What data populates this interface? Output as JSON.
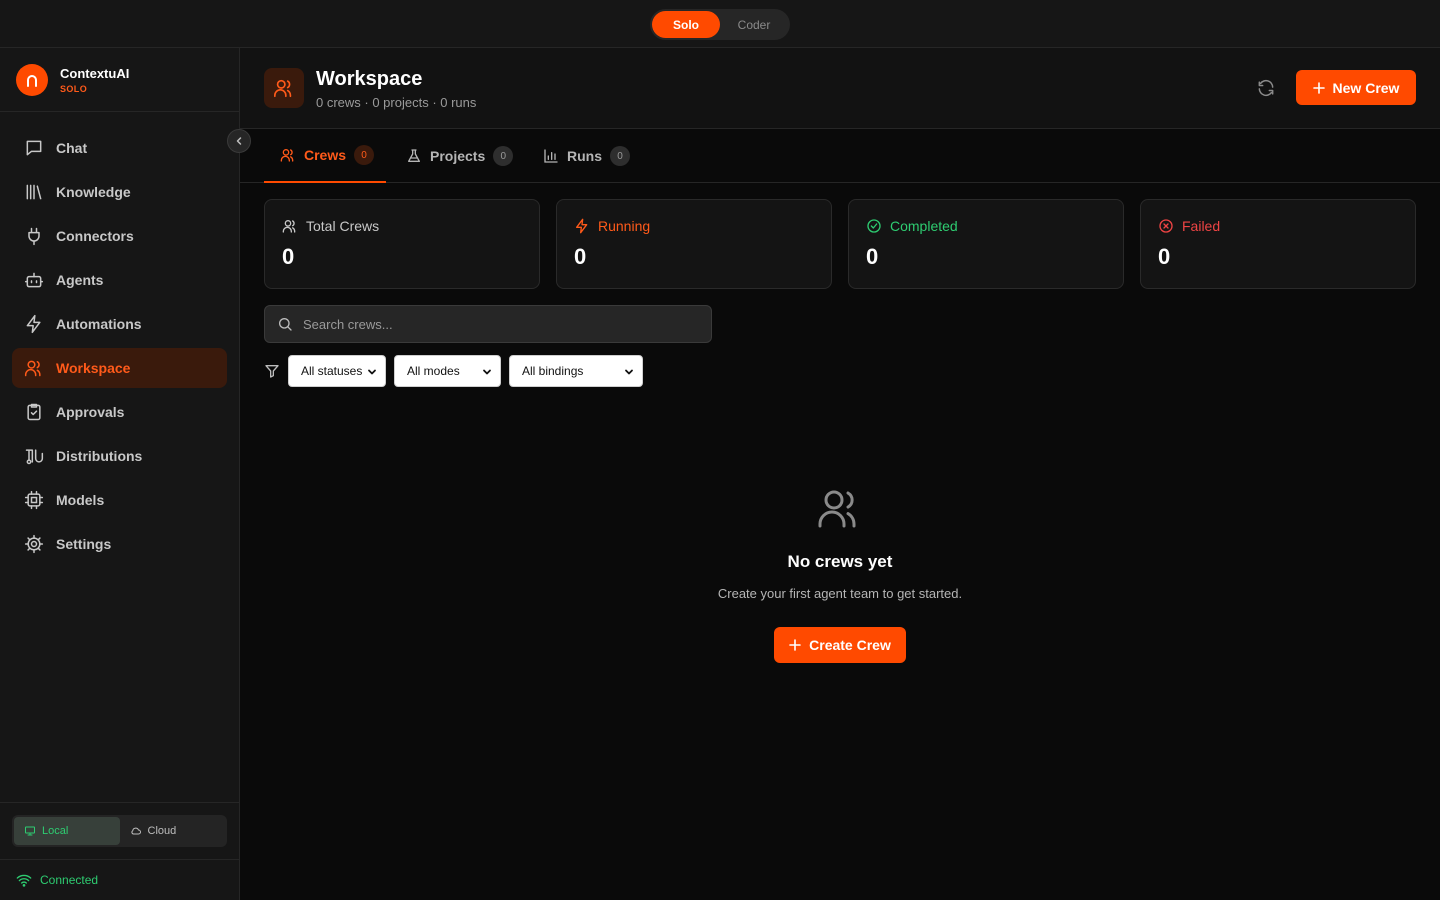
{
  "topbar": {
    "modes": [
      {
        "label": "Solo",
        "active": true
      },
      {
        "label": "Coder",
        "active": false
      }
    ]
  },
  "brand": {
    "name": "ContextuAI",
    "tier": "SOLO",
    "logo_icon": "arch-icon",
    "accent_color": "#ff4a00"
  },
  "sidebar": {
    "items": [
      {
        "label": "Chat",
        "icon": "chat-icon",
        "active": false
      },
      {
        "label": "Knowledge",
        "icon": "library-icon",
        "active": false
      },
      {
        "label": "Connectors",
        "icon": "plug-icon",
        "active": false
      },
      {
        "label": "Agents",
        "icon": "bot-icon",
        "active": false
      },
      {
        "label": "Automations",
        "icon": "zap-icon",
        "active": false
      },
      {
        "label": "Workspace",
        "icon": "users-icon",
        "active": true
      },
      {
        "label": "Approvals",
        "icon": "clipboard-check-icon",
        "active": false
      },
      {
        "label": "Distributions",
        "icon": "route-icon",
        "active": false
      },
      {
        "label": "Models",
        "icon": "cpu-icon",
        "active": false
      },
      {
        "label": "Settings",
        "icon": "gear-icon",
        "active": false
      }
    ],
    "env": {
      "local_label": "Local",
      "cloud_label": "Cloud",
      "active": "Local"
    },
    "connection": {
      "status": "Connected",
      "color": "#2ecc71"
    }
  },
  "header": {
    "title": "Workspace",
    "subtitle": "0 crews · 0 projects · 0 runs",
    "new_crew_label": "New Crew"
  },
  "tabs": [
    {
      "label": "Crews",
      "count": "0",
      "icon": "users-icon",
      "active": true
    },
    {
      "label": "Projects",
      "count": "0",
      "icon": "flask-icon",
      "active": false
    },
    {
      "label": "Runs",
      "count": "0",
      "icon": "bar-chart-icon",
      "active": false
    }
  ],
  "stats": [
    {
      "label": "Total Crews",
      "value": "0",
      "icon": "users-icon",
      "color": "#c8c8c8"
    },
    {
      "label": "Running",
      "value": "0",
      "icon": "zap-icon",
      "color": "#ff5a1a"
    },
    {
      "label": "Completed",
      "value": "0",
      "icon": "check-circle-icon",
      "color": "#2ecc71"
    },
    {
      "label": "Failed",
      "value": "0",
      "icon": "x-circle-icon",
      "color": "#ef4444"
    }
  ],
  "search": {
    "placeholder": "Search crews...",
    "value": ""
  },
  "filters": {
    "status": "All statuses",
    "mode": "All modes",
    "binding": "All bindings"
  },
  "empty_state": {
    "title": "No crews yet",
    "description": "Create your first agent team to get started.",
    "button_label": "Create Crew"
  }
}
